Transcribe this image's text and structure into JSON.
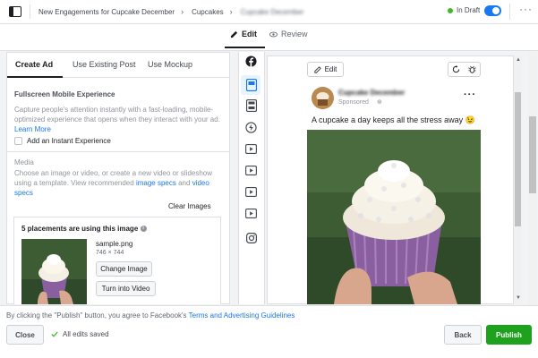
{
  "breadcrumb": {
    "campaign": "New Engagements for Cupcake December",
    "adset": "Cupcakes",
    "ad": "Cupcake December"
  },
  "header": {
    "status": "In Draft",
    "mode_tabs": [
      {
        "label": "Edit",
        "icon": "pencil-icon"
      },
      {
        "label": "Review",
        "icon": "eye-icon"
      }
    ]
  },
  "editor": {
    "subtabs": [
      "Create Ad",
      "Use Existing Post",
      "Use Mockup"
    ],
    "fullscreen": {
      "title": "Fullscreen Mobile Experience",
      "description": "Capture people's attention instantly with a fast-loading, mobile-optimized experience that opens when they interact with your ad.",
      "learn_more": "Learn More",
      "checkbox_label": "Add an Instant Experience"
    },
    "media": {
      "title": "Media",
      "description": "Choose an image or video, or create a new video or slideshow using a template. View recommended",
      "image_specs": "image specs",
      "and": "and",
      "video_specs": "video specs",
      "clear_images": "Clear Images",
      "placements_text": "5 placements are using this image",
      "filename": "sample.png",
      "dimensions": "746 × 744",
      "change_image": "Change Image",
      "turn_into_video": "Turn into Video"
    }
  },
  "preview": {
    "edit_label": "Edit",
    "page_name": "Cupcake December",
    "sponsored": "Sponsored",
    "caption": "A cupcake a day keeps all the stress away 😉"
  },
  "footer": {
    "legal_prefix": "By clicking the \"Publish\" button, you agree to Facebook's",
    "legal_link": "Terms and Advertising Guidelines",
    "close": "Close",
    "saved": "All edits saved",
    "back": "Back",
    "publish": "Publish"
  },
  "colors": {
    "accent": "#1877f2",
    "publish": "#1ea21e",
    "status_ok": "#42b72a"
  }
}
